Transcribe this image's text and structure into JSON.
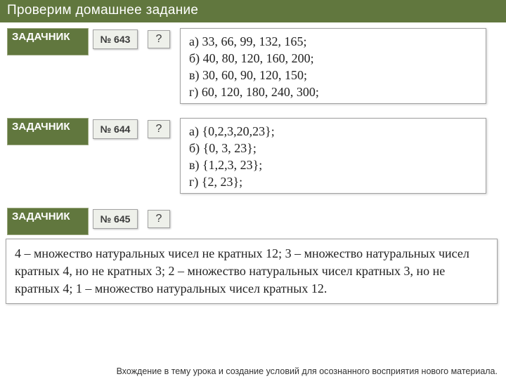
{
  "header": {
    "title": "Проверим домашнее задание"
  },
  "task_label": "ЗАДАЧНИК",
  "tasks": [
    {
      "number": "№ 643",
      "qmark": "?",
      "lines": [
        "а) 33, 66, 99, 132, 165;",
        "б) 40, 80, 120, 160, 200;",
        "в) 30, 60, 90, 120, 150;",
        "г) 60, 120, 180, 240, 300;"
      ]
    },
    {
      "number": "№ 644",
      "qmark": "?",
      "lines": [
        "а) {0,2,3,20,23};",
        "б) {0, 3, 23};",
        "в) {1,2,3, 23};",
        "г) {2, 23};"
      ]
    },
    {
      "number": "№ 645",
      "qmark": "?",
      "full_answer": "4 – множество натуральных чисел не кратных 12; 3 – множество натуральных чисел кратных 4, но не кратных 3; 2 – множество натуральных чисел кратных 3, но не кратных 4; 1 – множество натуральных чисел кратных 12."
    }
  ],
  "footer": "Вхождение в тему урока и создание условий для осознанного восприятия нового материала."
}
